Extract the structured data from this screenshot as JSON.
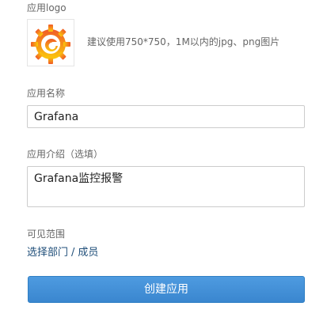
{
  "logo_section": {
    "label": "应用logo",
    "hint": "建议使用750*750，1M以内的jpg、png图片",
    "icon": "grafana-logo-icon",
    "colors": {
      "gradient_top": "#F05A28",
      "gradient_bottom": "#FBCA0A"
    }
  },
  "name_section": {
    "label": "应用名称",
    "value": "Grafana"
  },
  "description_section": {
    "label": "应用介绍（选填）",
    "value": "Grafana监控报警"
  },
  "visibility_section": {
    "label": "可见范围",
    "link_department": "选择部门",
    "separator": "/",
    "link_member": "成员"
  },
  "actions": {
    "create_label": "创建应用"
  },
  "colors": {
    "accent": "#3a86cf",
    "link": "#1f4e79"
  }
}
